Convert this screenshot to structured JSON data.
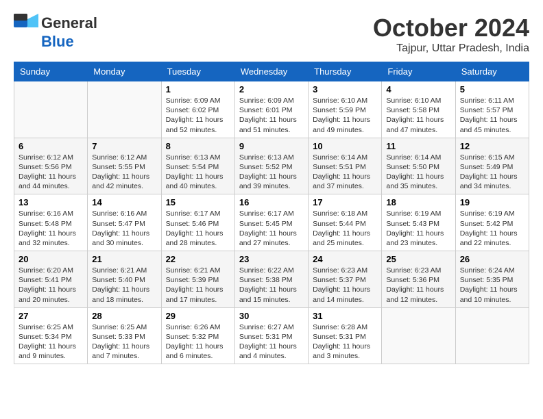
{
  "header": {
    "logo_general": "General",
    "logo_blue": "Blue",
    "month_title": "October 2024",
    "location": "Tajpur, Uttar Pradesh, India"
  },
  "columns": [
    "Sunday",
    "Monday",
    "Tuesday",
    "Wednesday",
    "Thursday",
    "Friday",
    "Saturday"
  ],
  "weeks": [
    [
      {
        "day": "",
        "info": ""
      },
      {
        "day": "",
        "info": ""
      },
      {
        "day": "1",
        "info": "Sunrise: 6:09 AM\nSunset: 6:02 PM\nDaylight: 11 hours and 52 minutes."
      },
      {
        "day": "2",
        "info": "Sunrise: 6:09 AM\nSunset: 6:01 PM\nDaylight: 11 hours and 51 minutes."
      },
      {
        "day": "3",
        "info": "Sunrise: 6:10 AM\nSunset: 5:59 PM\nDaylight: 11 hours and 49 minutes."
      },
      {
        "day": "4",
        "info": "Sunrise: 6:10 AM\nSunset: 5:58 PM\nDaylight: 11 hours and 47 minutes."
      },
      {
        "day": "5",
        "info": "Sunrise: 6:11 AM\nSunset: 5:57 PM\nDaylight: 11 hours and 45 minutes."
      }
    ],
    [
      {
        "day": "6",
        "info": "Sunrise: 6:12 AM\nSunset: 5:56 PM\nDaylight: 11 hours and 44 minutes."
      },
      {
        "day": "7",
        "info": "Sunrise: 6:12 AM\nSunset: 5:55 PM\nDaylight: 11 hours and 42 minutes."
      },
      {
        "day": "8",
        "info": "Sunrise: 6:13 AM\nSunset: 5:54 PM\nDaylight: 11 hours and 40 minutes."
      },
      {
        "day": "9",
        "info": "Sunrise: 6:13 AM\nSunset: 5:52 PM\nDaylight: 11 hours and 39 minutes."
      },
      {
        "day": "10",
        "info": "Sunrise: 6:14 AM\nSunset: 5:51 PM\nDaylight: 11 hours and 37 minutes."
      },
      {
        "day": "11",
        "info": "Sunrise: 6:14 AM\nSunset: 5:50 PM\nDaylight: 11 hours and 35 minutes."
      },
      {
        "day": "12",
        "info": "Sunrise: 6:15 AM\nSunset: 5:49 PM\nDaylight: 11 hours and 34 minutes."
      }
    ],
    [
      {
        "day": "13",
        "info": "Sunrise: 6:16 AM\nSunset: 5:48 PM\nDaylight: 11 hours and 32 minutes."
      },
      {
        "day": "14",
        "info": "Sunrise: 6:16 AM\nSunset: 5:47 PM\nDaylight: 11 hours and 30 minutes."
      },
      {
        "day": "15",
        "info": "Sunrise: 6:17 AM\nSunset: 5:46 PM\nDaylight: 11 hours and 28 minutes."
      },
      {
        "day": "16",
        "info": "Sunrise: 6:17 AM\nSunset: 5:45 PM\nDaylight: 11 hours and 27 minutes."
      },
      {
        "day": "17",
        "info": "Sunrise: 6:18 AM\nSunset: 5:44 PM\nDaylight: 11 hours and 25 minutes."
      },
      {
        "day": "18",
        "info": "Sunrise: 6:19 AM\nSunset: 5:43 PM\nDaylight: 11 hours and 23 minutes."
      },
      {
        "day": "19",
        "info": "Sunrise: 6:19 AM\nSunset: 5:42 PM\nDaylight: 11 hours and 22 minutes."
      }
    ],
    [
      {
        "day": "20",
        "info": "Sunrise: 6:20 AM\nSunset: 5:41 PM\nDaylight: 11 hours and 20 minutes."
      },
      {
        "day": "21",
        "info": "Sunrise: 6:21 AM\nSunset: 5:40 PM\nDaylight: 11 hours and 18 minutes."
      },
      {
        "day": "22",
        "info": "Sunrise: 6:21 AM\nSunset: 5:39 PM\nDaylight: 11 hours and 17 minutes."
      },
      {
        "day": "23",
        "info": "Sunrise: 6:22 AM\nSunset: 5:38 PM\nDaylight: 11 hours and 15 minutes."
      },
      {
        "day": "24",
        "info": "Sunrise: 6:23 AM\nSunset: 5:37 PM\nDaylight: 11 hours and 14 minutes."
      },
      {
        "day": "25",
        "info": "Sunrise: 6:23 AM\nSunset: 5:36 PM\nDaylight: 11 hours and 12 minutes."
      },
      {
        "day": "26",
        "info": "Sunrise: 6:24 AM\nSunset: 5:35 PM\nDaylight: 11 hours and 10 minutes."
      }
    ],
    [
      {
        "day": "27",
        "info": "Sunrise: 6:25 AM\nSunset: 5:34 PM\nDaylight: 11 hours and 9 minutes."
      },
      {
        "day": "28",
        "info": "Sunrise: 6:25 AM\nSunset: 5:33 PM\nDaylight: 11 hours and 7 minutes."
      },
      {
        "day": "29",
        "info": "Sunrise: 6:26 AM\nSunset: 5:32 PM\nDaylight: 11 hours and 6 minutes."
      },
      {
        "day": "30",
        "info": "Sunrise: 6:27 AM\nSunset: 5:31 PM\nDaylight: 11 hours and 4 minutes."
      },
      {
        "day": "31",
        "info": "Sunrise: 6:28 AM\nSunset: 5:31 PM\nDaylight: 11 hours and 3 minutes."
      },
      {
        "day": "",
        "info": ""
      },
      {
        "day": "",
        "info": ""
      }
    ]
  ]
}
